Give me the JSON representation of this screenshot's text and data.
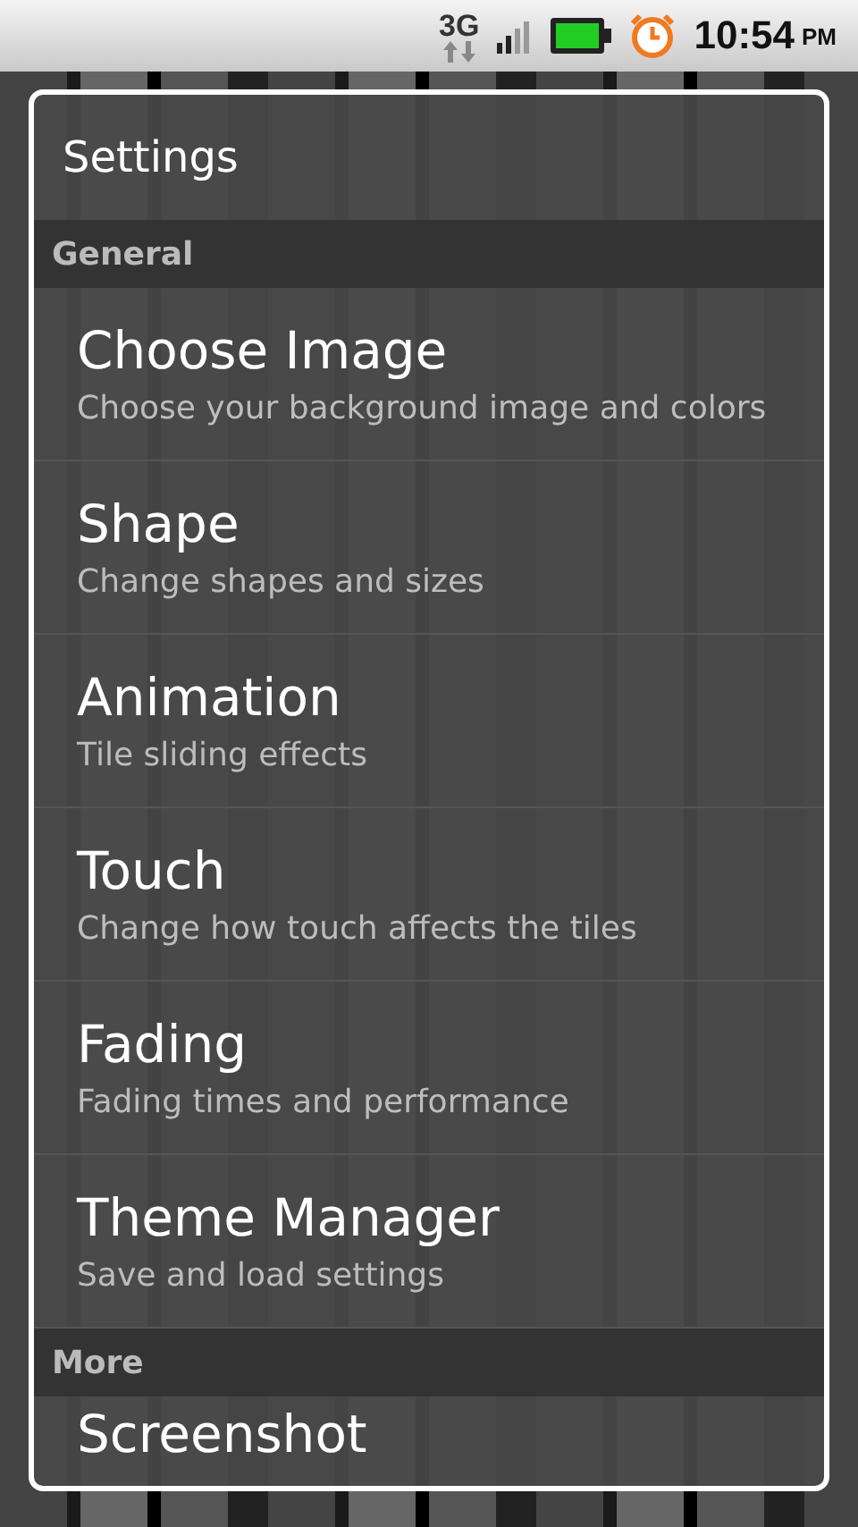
{
  "status_bar": {
    "network": "3G",
    "time": "10:54",
    "ampm": "PM"
  },
  "dialog": {
    "title": "Settings",
    "sections": [
      {
        "header": "General",
        "items": [
          {
            "title": "Choose Image",
            "summary": "Choose your background image and colors"
          },
          {
            "title": "Shape",
            "summary": "Change shapes and sizes"
          },
          {
            "title": "Animation",
            "summary": "Tile sliding effects"
          },
          {
            "title": "Touch",
            "summary": "Change how touch affects the tiles"
          },
          {
            "title": "Fading",
            "summary": "Fading times and performance"
          },
          {
            "title": "Theme Manager",
            "summary": "Save and load settings"
          }
        ]
      },
      {
        "header": "More",
        "items": [
          {
            "title": "Screenshot"
          }
        ]
      }
    ]
  }
}
